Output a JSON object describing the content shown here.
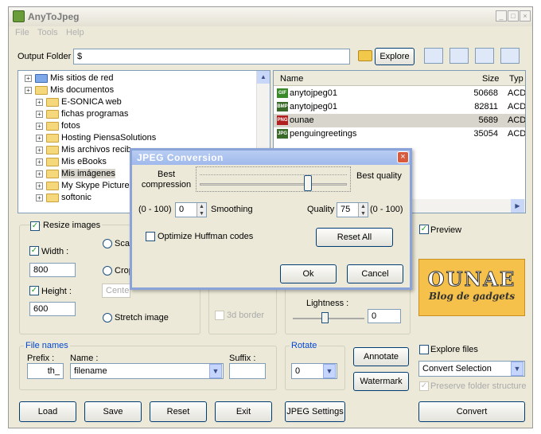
{
  "app": {
    "title": "AnyToJpeg",
    "menu": [
      "File",
      "Tools",
      "Help"
    ]
  },
  "output": {
    "label": "Output Folder",
    "value": "$",
    "explore_label": "Explore"
  },
  "tree": {
    "items": [
      {
        "label": "Mis sitios de red",
        "level": 0,
        "icon": "network-icon"
      },
      {
        "label": "Mis documentos",
        "level": 0,
        "icon": "folder-icon"
      },
      {
        "label": "E-SONICA web",
        "level": 1,
        "icon": "folder-icon"
      },
      {
        "label": "fichas programas",
        "level": 1,
        "icon": "folder-icon"
      },
      {
        "label": "fotos",
        "level": 1,
        "icon": "folder-icon"
      },
      {
        "label": "Hosting PiensaSolutions",
        "level": 1,
        "icon": "folder-icon"
      },
      {
        "label": "Mis archivos recib",
        "level": 1,
        "icon": "folder-icon"
      },
      {
        "label": "Mis eBooks",
        "level": 1,
        "icon": "folder-icon"
      },
      {
        "label": "Mis imágenes",
        "level": 1,
        "icon": "folder-icon"
      },
      {
        "label": "My Skype Pictures",
        "level": 1,
        "icon": "folder-icon"
      },
      {
        "label": "softonic",
        "level": 1,
        "icon": "folder-icon"
      }
    ]
  },
  "files": {
    "columns": [
      "Name",
      "Size",
      "Typ"
    ],
    "rows": [
      {
        "name": "anytojpeg01",
        "size": "50668",
        "type": "ACD",
        "icon": "GIF",
        "color": "#3a8a2a"
      },
      {
        "name": "anytojpeg01",
        "size": "82811",
        "type": "ACD",
        "icon": "BMP",
        "color": "#3a6a2a"
      },
      {
        "name": "ounae",
        "size": "5689",
        "type": "ACD",
        "icon": "PNG",
        "color": "#b02020"
      },
      {
        "name": "penguingreetings",
        "size": "35054",
        "type": "ACD",
        "icon": "JPG",
        "color": "#3a6a2a"
      }
    ]
  },
  "resize": {
    "label": "Resize images",
    "width_label": "Width :",
    "width_value": "800",
    "height_label": "Height :",
    "height_value": "600",
    "scale_label": "Scal",
    "crop_label": "Crop",
    "center_label": "Cente",
    "stretch_label": "Stretch image"
  },
  "border": {
    "label": "3d border"
  },
  "lightness": {
    "label": "Lightness :",
    "value": "0",
    "level": 0.45
  },
  "preview": {
    "label": "Preview",
    "logo_text": "OUNAE",
    "logo_sub": "Blog de gadgets"
  },
  "file_names": {
    "label": "File names",
    "prefix_label": "Prefix :",
    "prefix_value": "th_",
    "name_label": "Name :",
    "name_value": "filename",
    "suffix_label": "Suffix :",
    "suffix_value": ""
  },
  "rotate": {
    "label": "Rotate",
    "value": "0"
  },
  "annotate_label": "Annotate",
  "watermark_label": "Watermark",
  "explore_files": {
    "label": "Explore files",
    "select_value": "Convert Selection",
    "preserve_label": "Preserve folder structure"
  },
  "bottom": {
    "load": "Load",
    "save": "Save",
    "reset": "Reset",
    "exit": "Exit",
    "jpeg_settings": "JPEG Settings",
    "convert": "Convert"
  },
  "dialog": {
    "title": "JPEG Conversion",
    "best_compression": "Best compression",
    "best_quality": "Best quality",
    "range_left": "(0 - 100)",
    "smoothing_value": "0",
    "smoothing_label": "Smoothing",
    "quality_label": "Quality",
    "quality_value": "75",
    "range_right": "(0 - 100)",
    "quality_level": 0.75,
    "optimize_label": "Optimize Huffman codes",
    "reset_all": "Reset All",
    "ok": "Ok",
    "cancel": "Cancel"
  }
}
